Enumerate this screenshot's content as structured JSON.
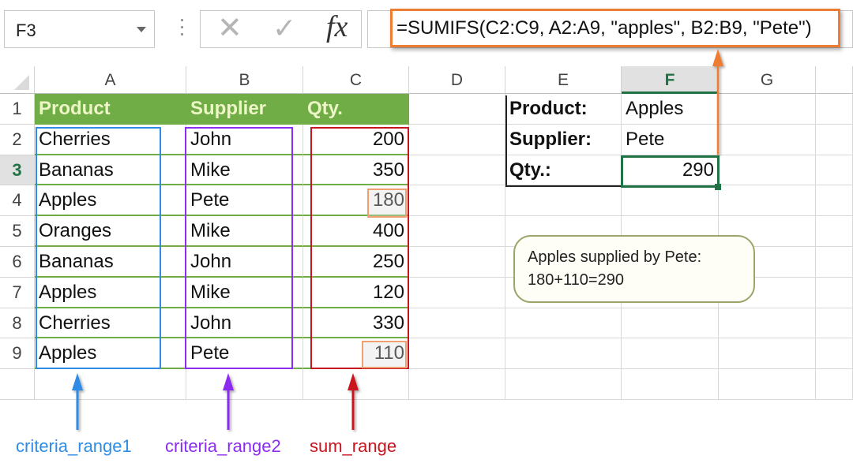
{
  "formula_bar": {
    "name_box": "F3",
    "cancel_icon": "✕",
    "enter_icon": "✓",
    "function_icon": "fx",
    "formula": "=SUMIFS(C2:C9, A2:A9, \"apples\", B2:B9, \"Pete\")"
  },
  "columns": [
    "A",
    "B",
    "C",
    "D",
    "E",
    "F",
    "G"
  ],
  "selected_column": "F",
  "rows": [
    "1",
    "2",
    "3",
    "4",
    "5",
    "6",
    "7",
    "8",
    "9"
  ],
  "selected_row": "3",
  "table": {
    "headers": [
      "Product",
      "Supplier",
      "Qty."
    ],
    "rows": [
      [
        "Cherries",
        "John",
        "200"
      ],
      [
        "Bananas",
        "Mike",
        "350"
      ],
      [
        "Apples",
        "Pete",
        "180"
      ],
      [
        "Oranges",
        "Mike",
        "400"
      ],
      [
        "Bananas",
        "John",
        "250"
      ],
      [
        "Apples",
        "Mike",
        "120"
      ],
      [
        "Cherries",
        "John",
        "330"
      ],
      [
        "Apples",
        "Pete",
        "110"
      ]
    ]
  },
  "criteria": {
    "product_label": "Product:",
    "product_value": "Apples",
    "supplier_label": "Supplier:",
    "supplier_value": "Pete",
    "qty_label": "Qty.:",
    "qty_value": "290"
  },
  "callout": {
    "line1": "Apples supplied by Pete:",
    "line2": "180+110=290"
  },
  "annotations": {
    "criteria_range1": "criteria_range1",
    "criteria_range2": "criteria_range2",
    "sum_range": "sum_range"
  },
  "colors": {
    "header_green": "#70ad47",
    "selection_green": "#217346",
    "range1_blue": "#2e8ce6",
    "range2_purple": "#8b2cf0",
    "sum_range_red": "#c8141e",
    "formula_highlight_orange": "#ed7d31"
  }
}
